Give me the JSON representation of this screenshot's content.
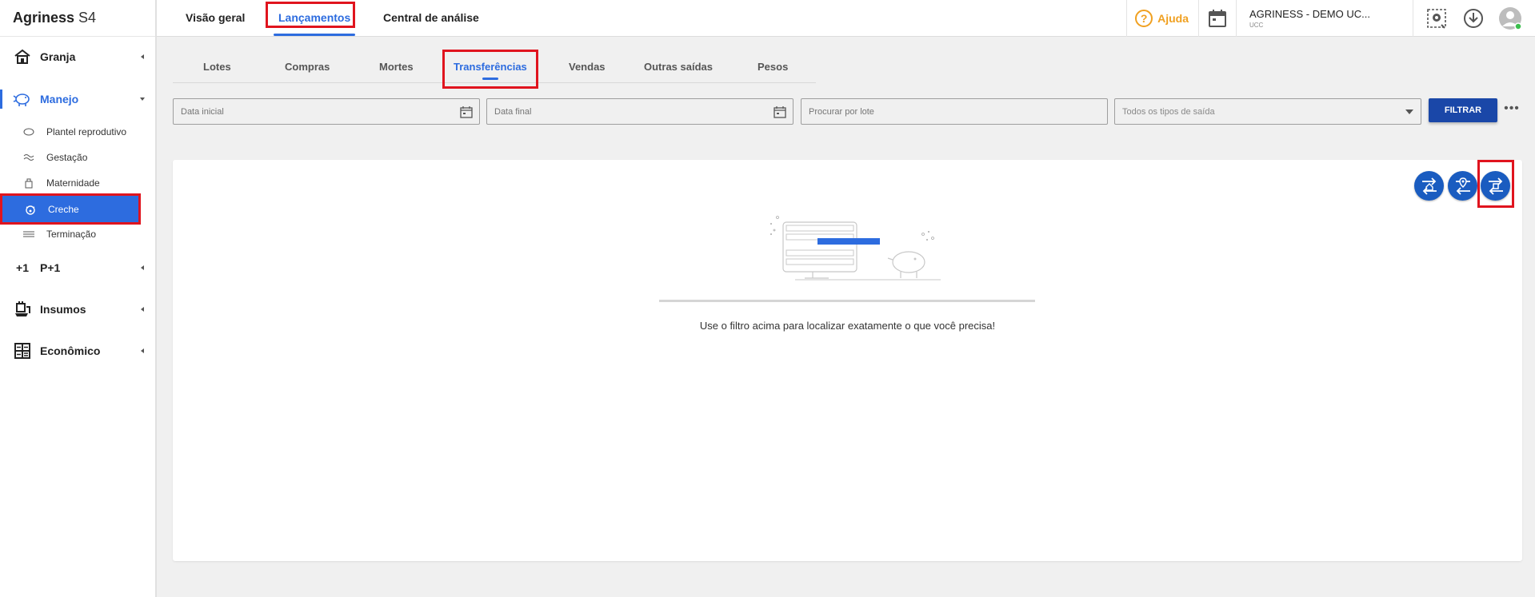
{
  "app": {
    "brand": "Agriness",
    "brand_suffix": "S4"
  },
  "top_tabs": [
    "Visão geral",
    "Lançamentos",
    "Central de análise"
  ],
  "top_active": "Lançamentos",
  "help": {
    "label": "Ajuda",
    "icon": "question-circle-icon"
  },
  "farm": {
    "name": "AGRINESS - DEMO UC...",
    "sub": "UCC"
  },
  "sidebar": {
    "groups": [
      {
        "label": "Granja",
        "icon": "farm-house-icon"
      },
      {
        "label": "Manejo",
        "icon": "pig-icon"
      },
      {
        "label": "P+1",
        "icon": "plus-one-icon"
      },
      {
        "label": "Insumos",
        "icon": "supplies-icon"
      },
      {
        "label": "Econômico",
        "icon": "calculator-icon"
      }
    ],
    "manejo_items": [
      {
        "label": "Plantel reprodutivo",
        "icon": "sow-icon"
      },
      {
        "label": "Gestação",
        "icon": "gestation-icon"
      },
      {
        "label": "Maternidade",
        "icon": "maternity-icon"
      },
      {
        "label": "Creche",
        "icon": "nursery-icon"
      },
      {
        "label": "Terminação",
        "icon": "finishing-icon"
      }
    ],
    "selected": "Creche"
  },
  "sub_tabs": [
    "Lotes",
    "Compras",
    "Mortes",
    "Transferências",
    "Vendas",
    "Outras saídas",
    "Pesos"
  ],
  "sub_active": "Transferências",
  "filters": {
    "start_date_placeholder": "Data inicial",
    "end_date_placeholder": "Data final",
    "lot_search_placeholder": "Procurar por lote",
    "exit_type_value": "Todos os tipos de saída",
    "filter_button": "FILTRAR",
    "more": "•••"
  },
  "actions": [
    "transfer-farm-icon",
    "transfer-location-icon",
    "transfer-room-icon"
  ],
  "empty_state": {
    "message": "Use o filtro acima para localizar exatamente o que você precisa!"
  },
  "colors": {
    "accent": "#2d6cdf",
    "primary_button": "#1a47a8",
    "help": "#f0a020",
    "highlight": "#e0141e"
  }
}
